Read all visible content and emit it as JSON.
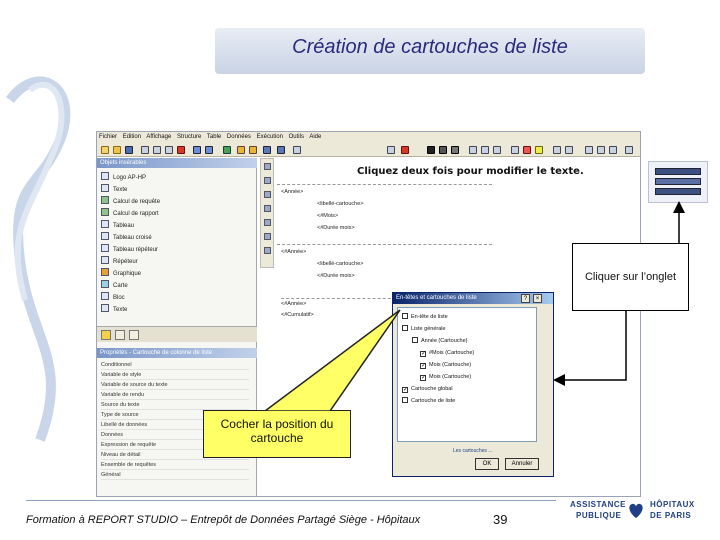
{
  "slide": {
    "title": "Création de cartouches de liste",
    "footer": "Formation à REPORT STUDIO – Entrepôt de Données Partagé Siège - Hôpitaux",
    "page_number": "39"
  },
  "logo": {
    "line1": "ASSISTANCE",
    "line2": "PUBLIQUE",
    "line3": "HÔPITAUX",
    "line4": "DE PARIS"
  },
  "app": {
    "menu": [
      "Fichier",
      "Edition",
      "Affichage",
      "Structure",
      "Table",
      "Données",
      "Exécution",
      "Outils",
      "Aide"
    ],
    "objects_header": "Objets insérables",
    "objects": [
      "Logo AP-HP",
      "Texte",
      "Calcul de requête",
      "Calcul de rapport",
      "Tableau",
      "Tableau croisé",
      "Tableau répéteur",
      "Répéteur",
      "Graphique",
      "Carte",
      "Bloc",
      "Texte"
    ],
    "props_header_a": "Propriétés",
    "props_header_b": "Cartouche de colonne de liste",
    "props": [
      "Conditionnel",
      "Variable de style",
      "Variable de source du texte",
      "Variable de rendu",
      "Source du texte",
      "Type de source",
      "Libellé de données",
      "Données",
      "Expression de requête",
      "Niveau de détail",
      "Ensemble de requêtes",
      "Général"
    ],
    "canvas_banner": "Cliquez deux fois pour modifier le texte.",
    "canvas_rows": [
      "<Année>",
      "<#Mois>",
      "<libellé-cartouche>",
      "<#Durée mois>",
      "<#Année>",
      "<#Cumulatif>"
    ]
  },
  "dialog": {
    "title": "En-têtes et cartouches de liste",
    "items": [
      {
        "label": "En-tête de liste",
        "checked": false
      },
      {
        "label": "Liste générale",
        "checked": false
      },
      {
        "label": "Année (Cartouche)",
        "checked": false
      },
      {
        "label": "#Mois (Cartouche)",
        "checked": true
      },
      {
        "label": "Mois (Cartouche)",
        "checked": true
      },
      {
        "label": "Mois (Cartouche)",
        "checked": true
      },
      {
        "label": "Cartouche global",
        "checked": true
      },
      {
        "label": "Cartouche de liste",
        "checked": false
      }
    ],
    "hint": "Les cartouches ...",
    "ok": "OK",
    "cancel": "Annuler"
  },
  "callouts": {
    "onglet": "Cliquer sur l’onglet",
    "cocher": "Cocher la position du cartouche"
  }
}
